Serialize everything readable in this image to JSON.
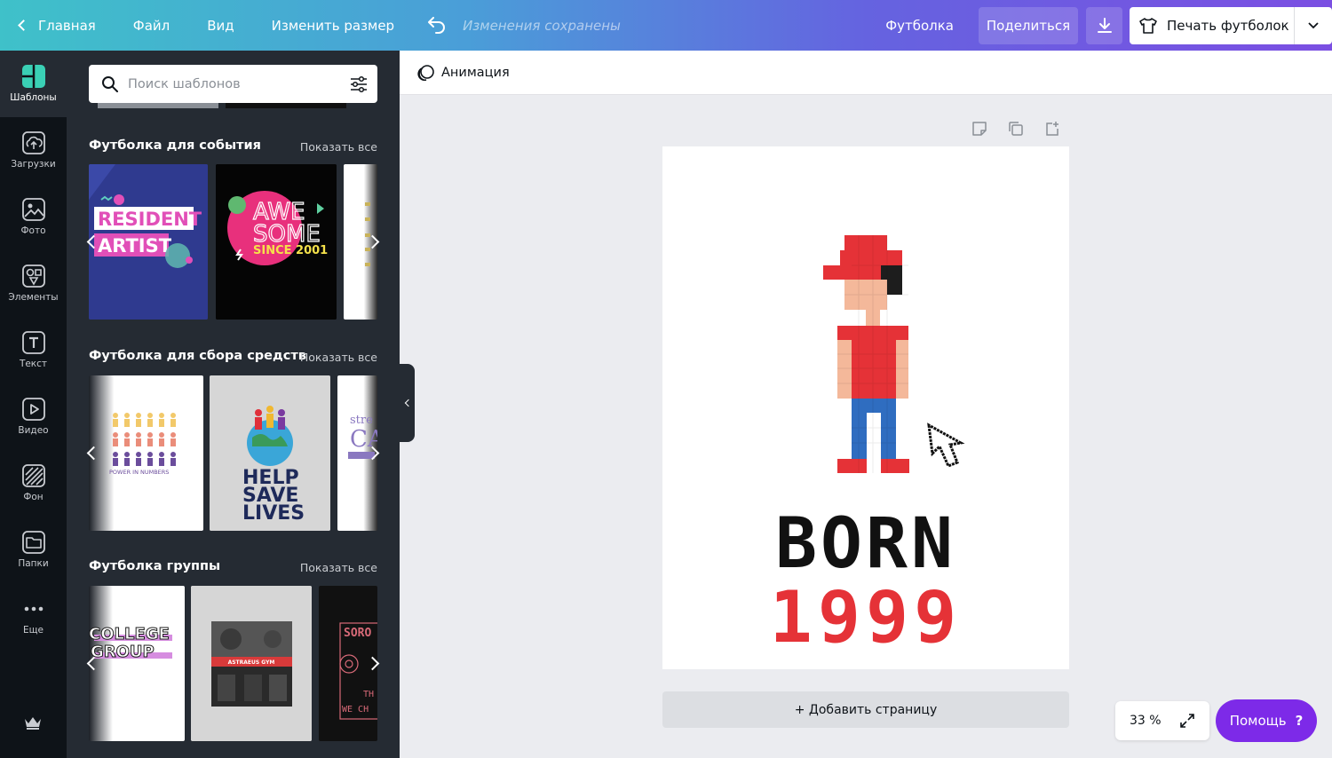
{
  "topbar": {
    "home": "Главная",
    "file": "Файл",
    "view": "Вид",
    "resize": "Изменить размер",
    "status": "Изменения сохранены",
    "product": "Футболка",
    "share": "Поделиться",
    "print": "Печать футболок"
  },
  "nav": {
    "items": [
      {
        "label": "Шаблоны",
        "icon": "templates-icon"
      },
      {
        "label": "Загрузки",
        "icon": "cloud-upload-icon"
      },
      {
        "label": "Фото",
        "icon": "photo-icon"
      },
      {
        "label": "Элементы",
        "icon": "shapes-icon"
      },
      {
        "label": "Текст",
        "icon": "text-icon"
      },
      {
        "label": "Видео",
        "icon": "play-icon"
      },
      {
        "label": "Фон",
        "icon": "pattern-icon"
      },
      {
        "label": "Папки",
        "icon": "folder-icon"
      },
      {
        "label": "Еще",
        "icon": "more-icon"
      }
    ]
  },
  "panel": {
    "search_placeholder": "Поиск шаблонов",
    "show_all": "Показать все",
    "sections": [
      {
        "title": "Футболка для события"
      },
      {
        "title": "Футболка для сбора средств"
      },
      {
        "title": "Футболка группы"
      }
    ],
    "thumbs": {
      "resident_line1": "RESIDENT",
      "resident_line2": "ARTIST",
      "awesome_line1": "AWE",
      "awesome_line2": "SOME",
      "awesome_line3": "SINCE 2001",
      "power": "POWER IN NUMBERS",
      "help1": "HELP",
      "help2": "SAVE",
      "help3": "LIVES",
      "stre": "stre",
      "ca": "CA",
      "college1": "COLLEGE",
      "college2": "GROUP",
      "gym": "ASTRAEUS GYM",
      "soro": "SORO",
      "th": "TH",
      "wech": "WE CH"
    }
  },
  "editor": {
    "animation": "Анимация",
    "add_page": "+ Добавить страницу",
    "zoom": "33 %",
    "help": "Помощь",
    "help_q": "?"
  },
  "design": {
    "born": "BORN",
    "year": "1999"
  },
  "colors": {
    "accent": "#7d2ae8",
    "panel": "#252b33",
    "nav": "#0e1318",
    "pixel_red": "#e53237",
    "pixel_skin": "#f4b89a",
    "pixel_blue": "#2f6dc0"
  }
}
